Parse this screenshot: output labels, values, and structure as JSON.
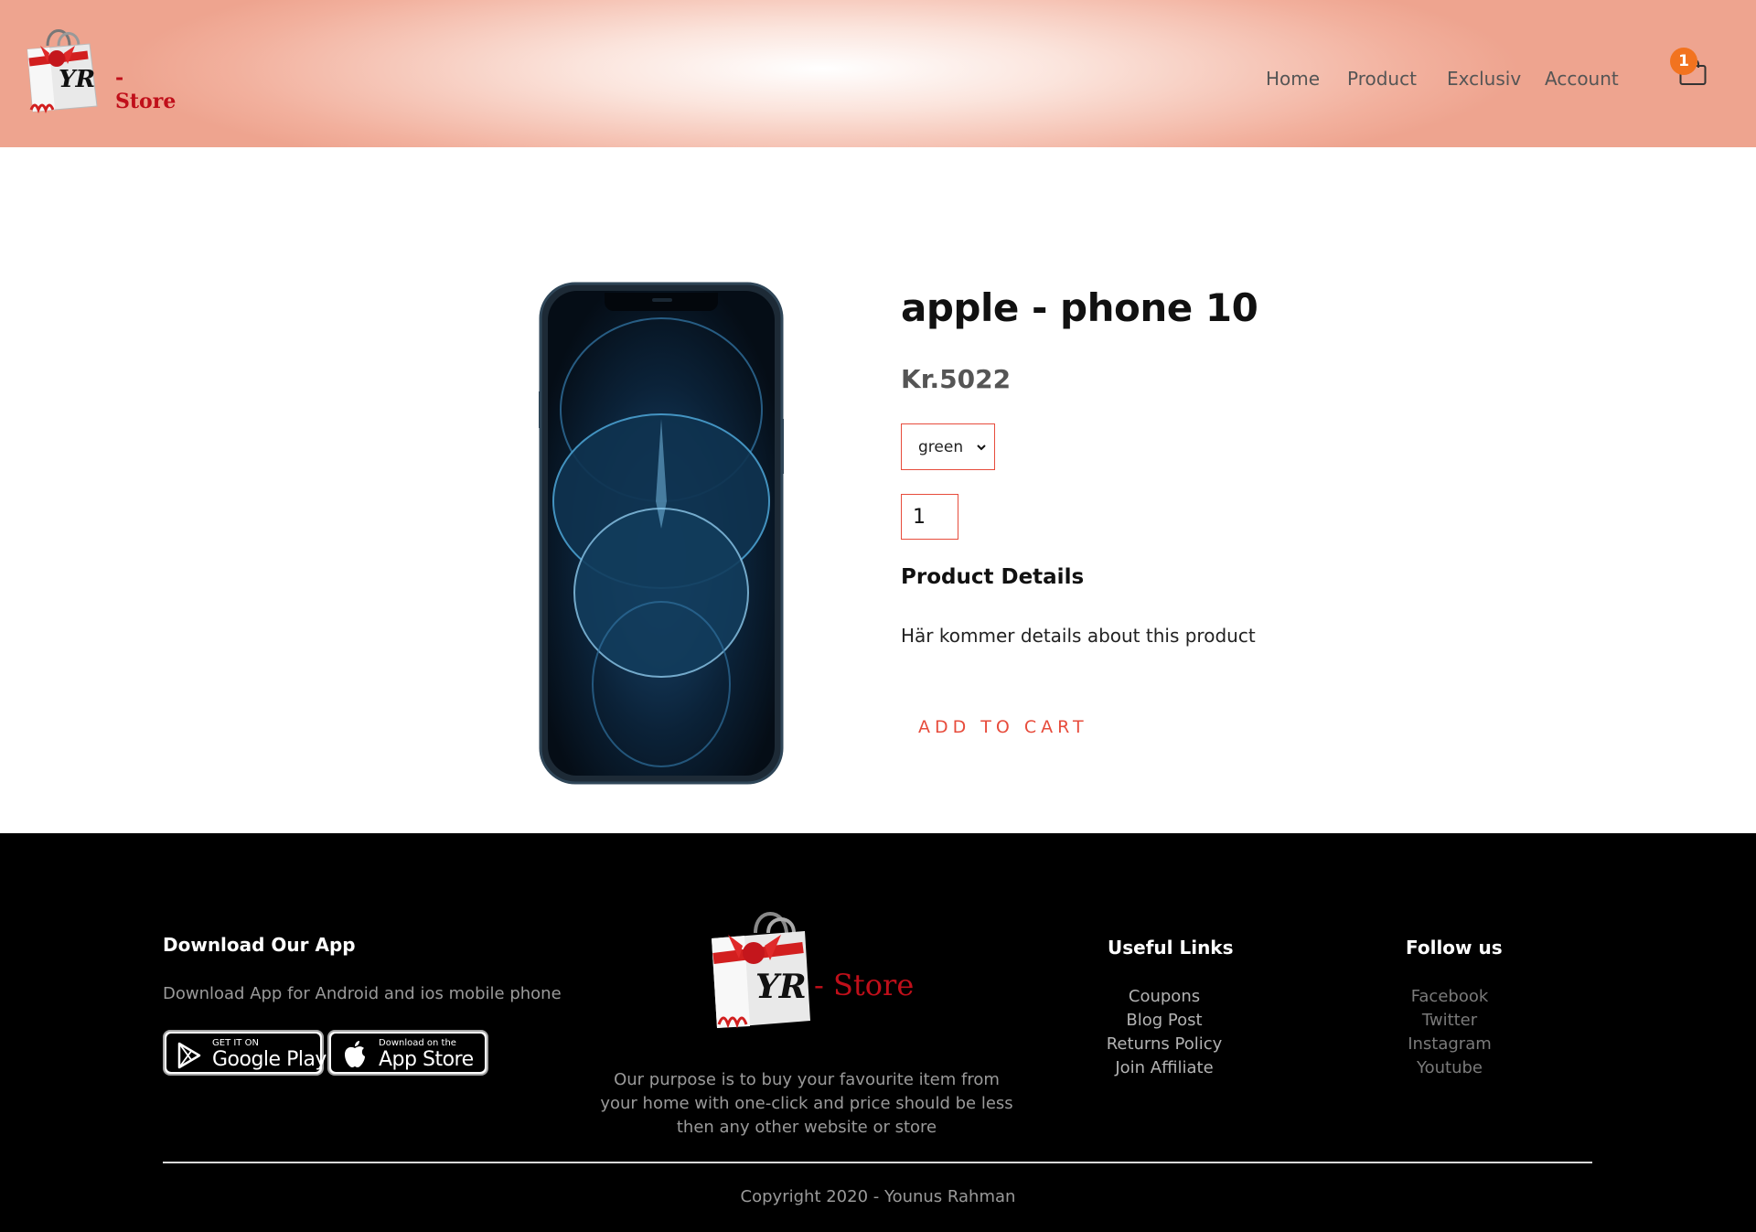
{
  "header": {
    "logo_text": "- Store",
    "logo_mark": "YR",
    "nav": [
      {
        "label": "Home"
      },
      {
        "label": "Product"
      },
      {
        "label": "Exclusiv"
      },
      {
        "label": "Account"
      }
    ],
    "cart_count": "1",
    "cart_icon": "shopping-bag-icon"
  },
  "product": {
    "title": "apple - phone 10",
    "price": "Kr.5022",
    "color_select": {
      "selected": "green"
    },
    "quantity": "1",
    "details_heading": "Product Details",
    "details_text": "Här kommer details about this product",
    "add_to_cart_label": "ADD TO CART"
  },
  "footer": {
    "app": {
      "heading": "Download Our App",
      "text": "Download App for Android and ios mobile phone",
      "google_play": {
        "small": "GET IT ON",
        "big": "Google Play"
      },
      "app_store": {
        "small": "Download on the",
        "big": "App Store"
      }
    },
    "logo_text": "- Store",
    "logo_mark": "YR",
    "purpose": "Our purpose is to buy your favourite item from your home with one-click and price should be less then any other website or store",
    "useful": {
      "heading": "Useful Links",
      "items": [
        "Coupons",
        "Blog Post",
        "Returns Policy",
        "Join Affiliate"
      ]
    },
    "follow": {
      "heading": "Follow us",
      "items": [
        "Facebook",
        "Twitter",
        "Instagram",
        "Youtube"
      ]
    },
    "copyright": "Copyright 2020 - Younus Rahman"
  },
  "colors": {
    "accent": "#e74c3c",
    "badge": "#f2731f",
    "header_peach": "#f2b09d",
    "footer_bg": "#000000"
  }
}
